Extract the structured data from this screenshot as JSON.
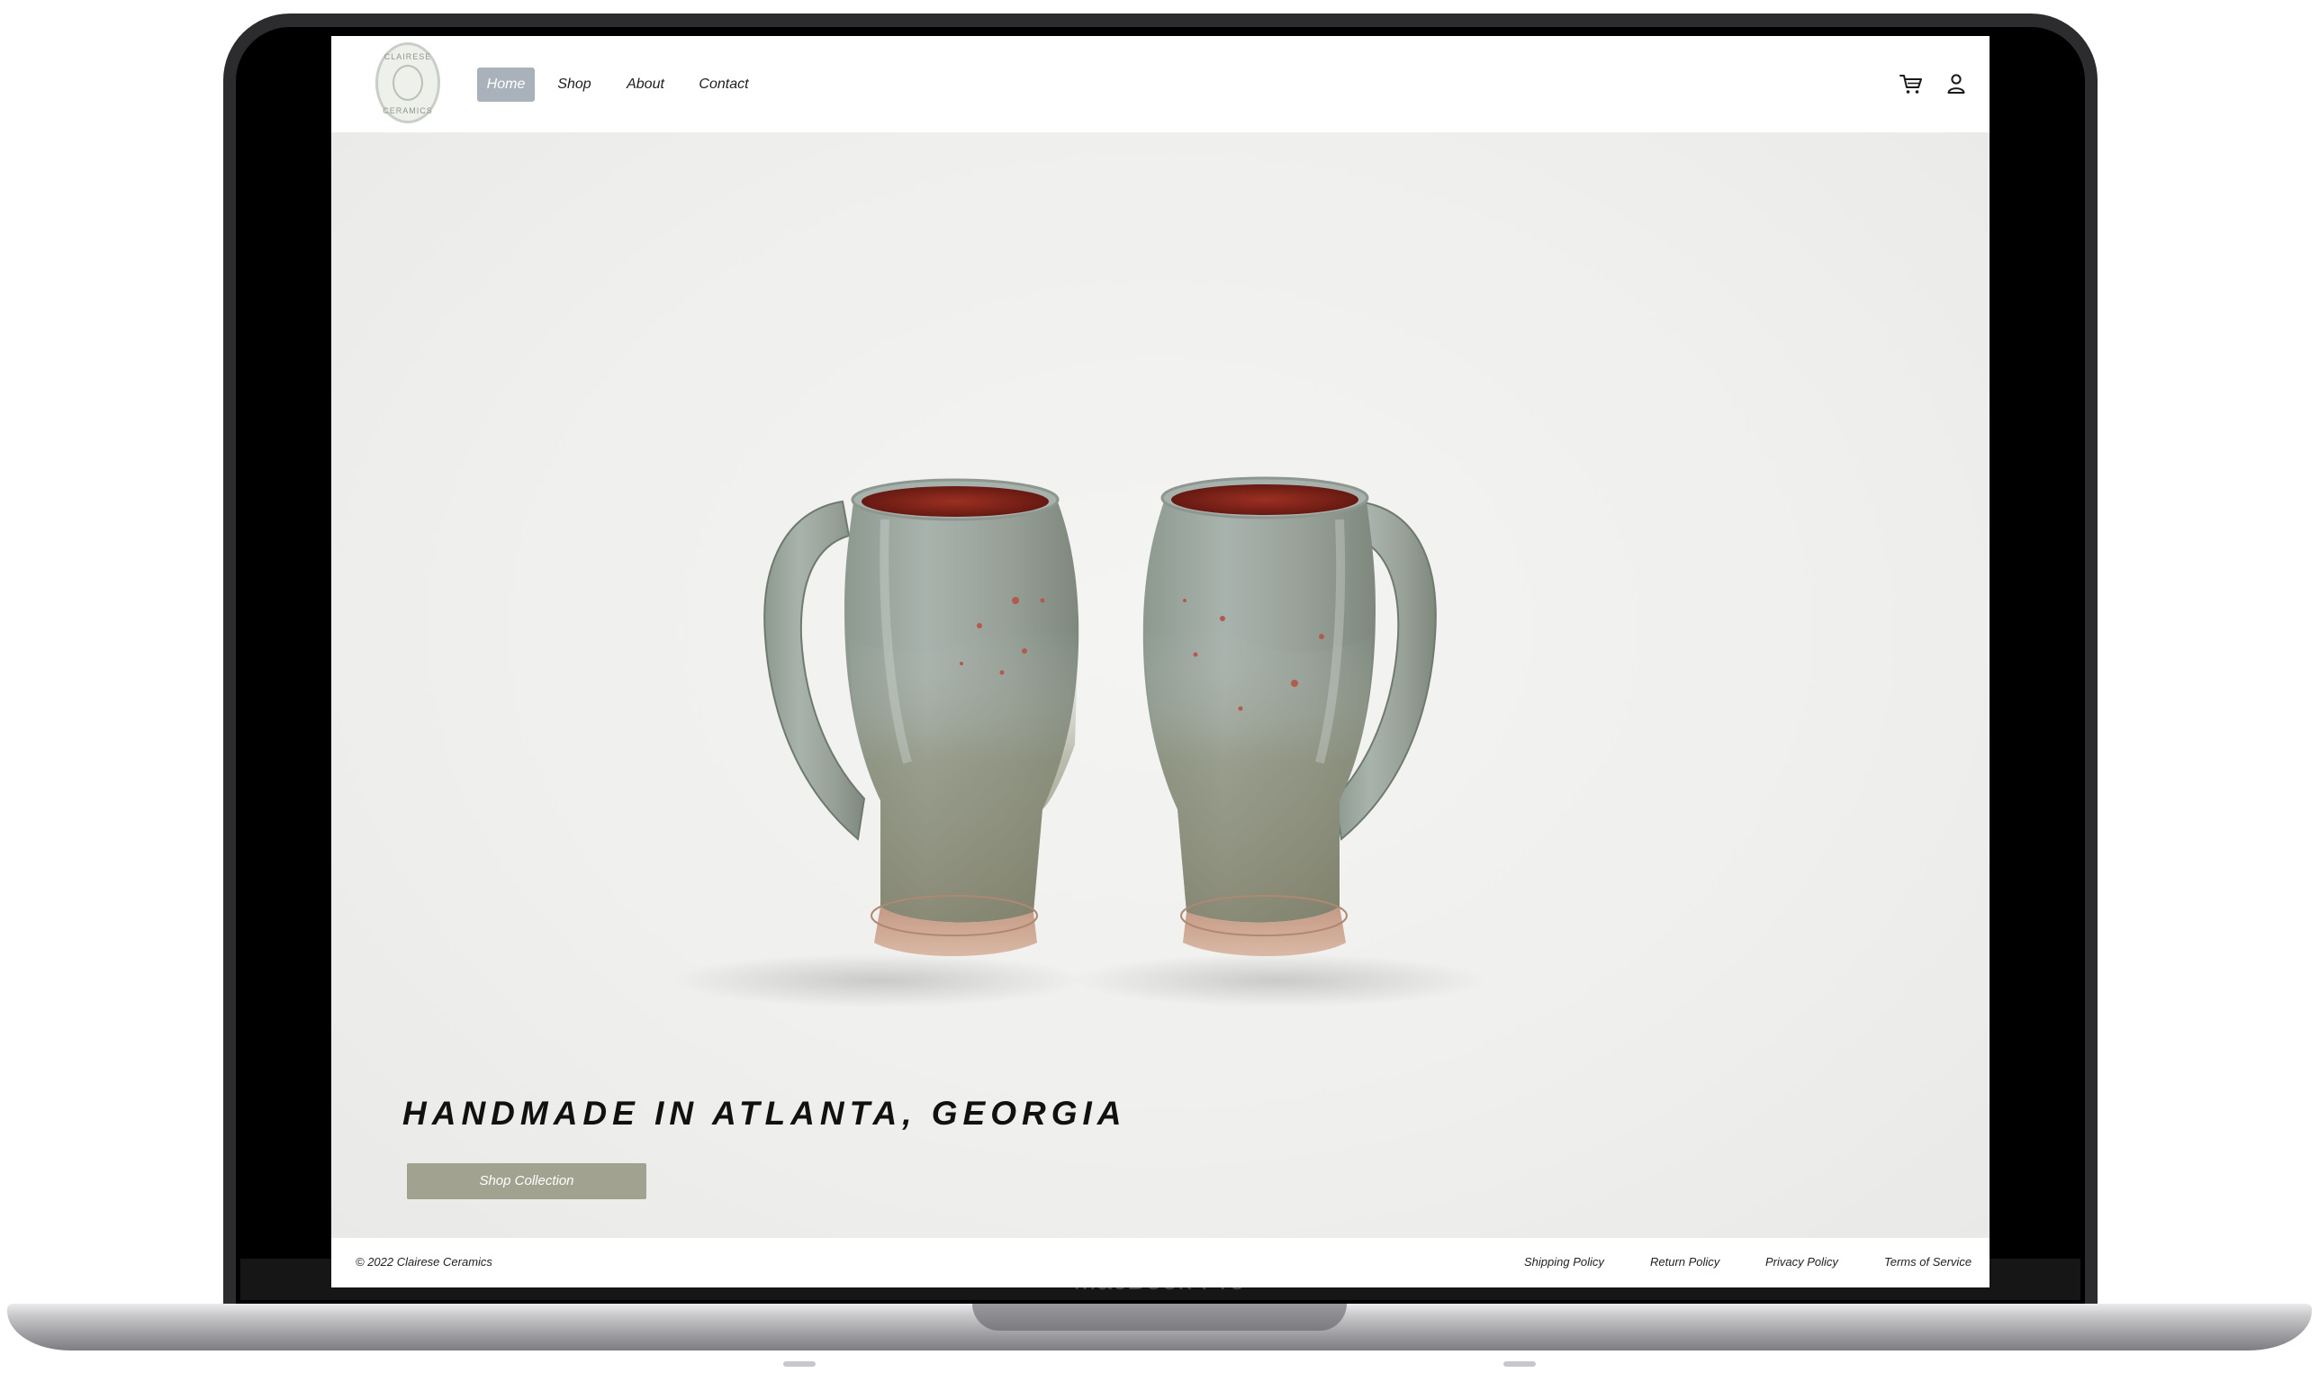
{
  "site": {
    "logo_text_top": "CLAIRESE",
    "logo_text_bottom": "CERAMICS",
    "nav": [
      {
        "label": "Home",
        "active": true
      },
      {
        "label": "Shop"
      },
      {
        "label": "About"
      },
      {
        "label": "Contact"
      }
    ],
    "icons": {
      "cart": "cart-icon",
      "account": "user-icon"
    }
  },
  "hero": {
    "title": "HANDMADE IN ATLANTA, GEORGIA",
    "cta_label": "Shop Collection",
    "image_subject": "two celadon glazed ceramic mugs with red interiors"
  },
  "footer": {
    "copyright": "© 2022 Clairese Ceramics",
    "links": [
      "Shipping Policy",
      "Return Policy",
      "Privacy Policy",
      "Terms of Service"
    ]
  },
  "device": {
    "model_label": "MacBook Pro"
  },
  "colors": {
    "nav_active_bg": "#a9b2ba",
    "cta_bg": "#a1a290",
    "glaze": "#9aa59c",
    "interior": "#7e2218",
    "clay_foot": "#c99c86"
  }
}
